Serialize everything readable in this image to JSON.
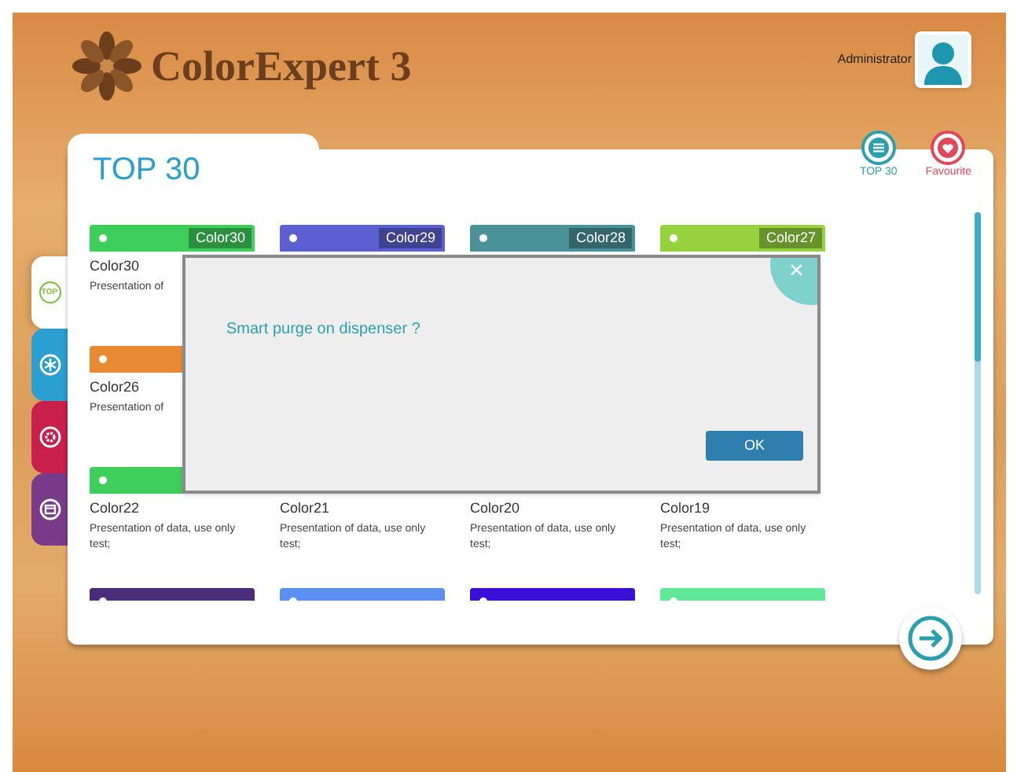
{
  "header": {
    "app_title": "ColorExpert 3",
    "user": "Administrator"
  },
  "panel": {
    "title": "TOP 30",
    "actions": [
      {
        "label": "TOP 30",
        "kind": "list"
      },
      {
        "label": "Favourite",
        "kind": "heart"
      }
    ]
  },
  "side_tabs": [
    {
      "kind": "top",
      "label": "TOP",
      "selected": true
    },
    {
      "kind": "snowflake",
      "selected": false
    },
    {
      "kind": "gear",
      "selected": false
    },
    {
      "kind": "calendar",
      "selected": false
    }
  ],
  "card_rows": [
    [
      {
        "color": "#3ecf5a",
        "tag": "Color30",
        "name": "Color30",
        "description": "Presentation of"
      },
      {
        "color": "#5b5fd0",
        "tag": "Color29"
      },
      {
        "color": "#4a9199",
        "tag": "Color28"
      },
      {
        "color": "#96d23e",
        "tag": "Color27"
      }
    ],
    [
      {
        "color": "#e88a32",
        "name": "Color26",
        "description": "Presentation of"
      }
    ],
    [
      {
        "color": "#3ecf5a",
        "name": "Color22",
        "description": "Presentation of data, use only test;"
      },
      {
        "name": "Color21",
        "description": "Presentation of data, use only test;"
      },
      {
        "name": "Color20",
        "description": "Presentation of data, use only test;"
      },
      {
        "name": "Color19",
        "description": "Presentation of data, use only test;"
      }
    ],
    [
      {
        "color": "#4a2d7a"
      },
      {
        "color": "#5b8ff0"
      },
      {
        "color": "#3a10d8"
      },
      {
        "color": "#5fe896"
      }
    ]
  ],
  "dialog": {
    "message": "Smart purge on dispenser ?",
    "close": "×",
    "button": "OK"
  }
}
